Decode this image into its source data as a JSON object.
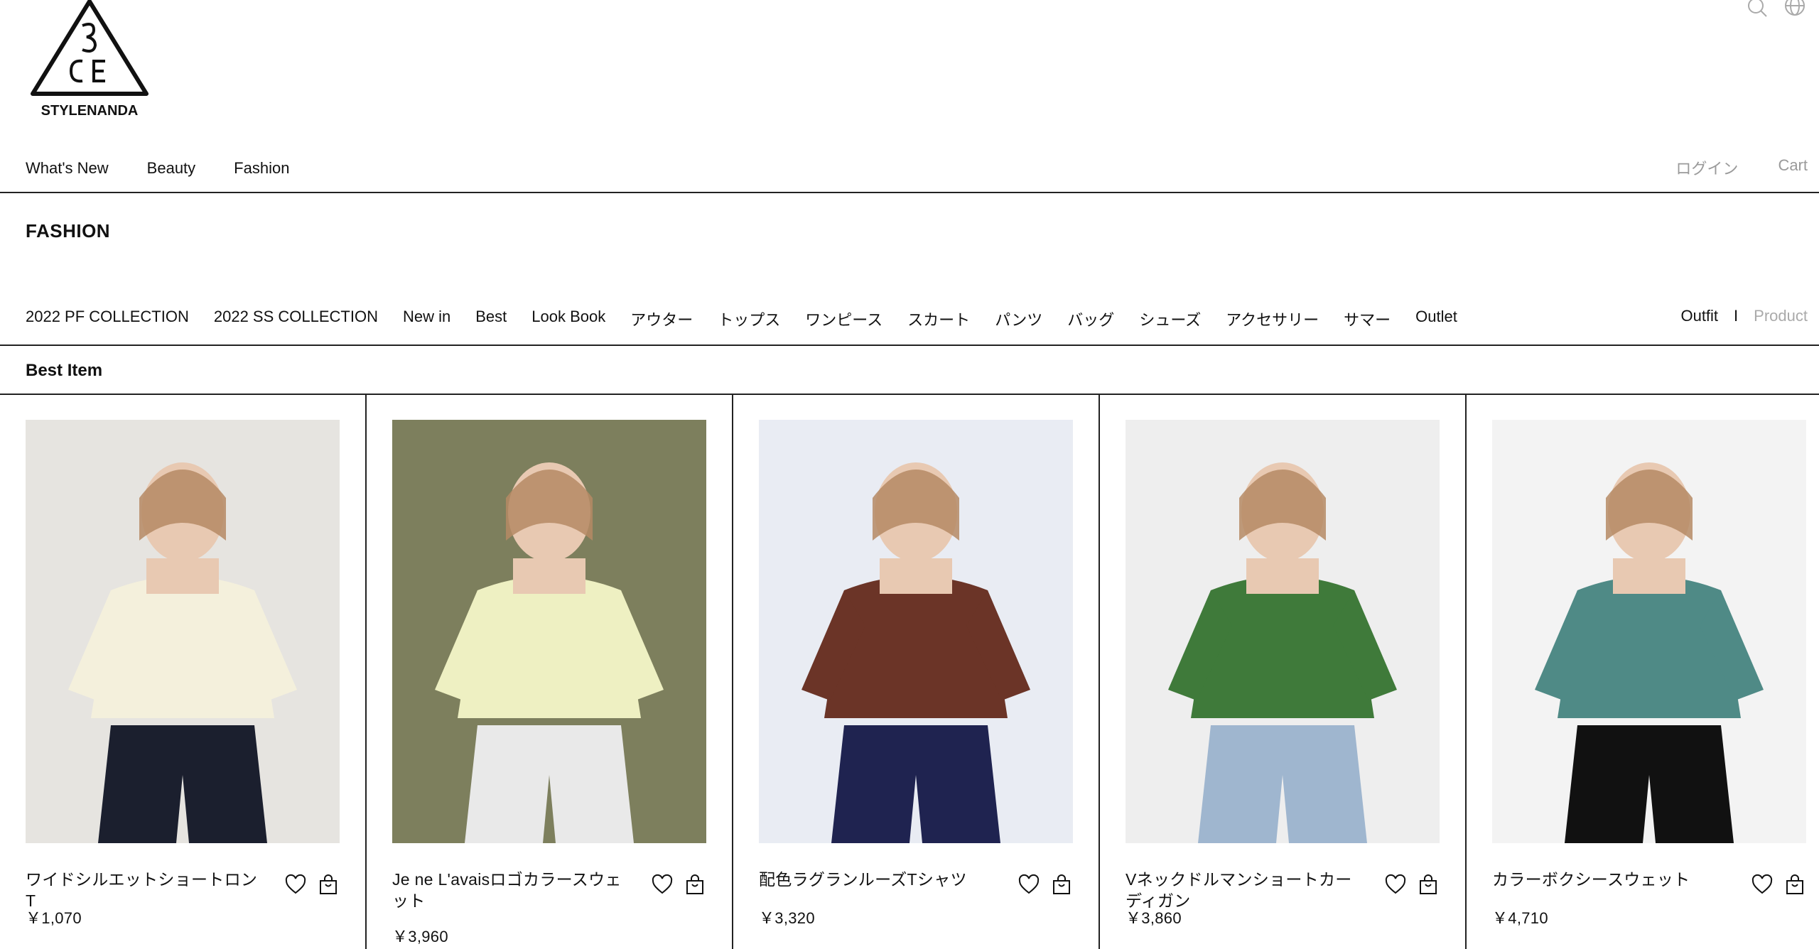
{
  "brand": {
    "logo_text": "3CE",
    "logo_sub": "STYLENANDA"
  },
  "header": {
    "icons": [
      "search-icon",
      "globe-icon"
    ],
    "main_nav": [
      "What's New",
      "Beauty",
      "Fashion"
    ],
    "login_label": "ログイン",
    "cart_label": "Cart"
  },
  "section": {
    "title": "FASHION",
    "categories": [
      "2022 PF COLLECTION",
      "2022 SS COLLECTION",
      "New in",
      "Best",
      "Look Book",
      "アウター",
      "トップス",
      "ワンピース",
      "スカート",
      "パンツ",
      "バッグ",
      "シューズ",
      "アクセサリー",
      "サマー",
      "Outlet"
    ],
    "view_toggle": {
      "outfit_label": "Outfit",
      "separator": "I",
      "product_label": "Product",
      "active": "Outfit"
    }
  },
  "best": {
    "title": "Best Item",
    "products": [
      {
        "name": "ワイドシルエットショートロンT",
        "price": "￥1,070",
        "bg": "#e6e4e0",
        "top": "#f4f0dc",
        "bottom": "#1b1f2e"
      },
      {
        "name": "Je ne L'avaisロゴカラースウェット",
        "price": "￥3,960",
        "bg": "#7d7f5d",
        "top": "#eef0c2",
        "bottom": "#e9e9e9"
      },
      {
        "name": "配色ラグランルーズTシャツ",
        "price": "￥3,320",
        "bg": "#e9ecf3",
        "top": "#6b3427",
        "bottom": "#1f2350"
      },
      {
        "name": "Vネックドルマンショートカーディガン",
        "price": "￥3,860",
        "bg": "#eeeeee",
        "top": "#3f7a3a",
        "bottom": "#9fb6cf"
      },
      {
        "name": "カラーボクシースウェット",
        "price": "￥4,710",
        "bg": "#f3f3f3",
        "top": "#4f8a86",
        "bottom": "#111111"
      }
    ]
  },
  "colors": {
    "text": "#111111",
    "muted": "#9a9a9a",
    "rule": "#222222"
  }
}
